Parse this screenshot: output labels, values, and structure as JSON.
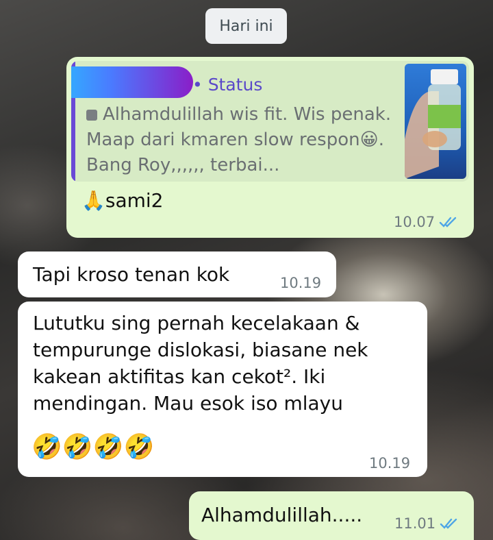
{
  "date_chip": "Hari ini",
  "messages": [
    {
      "status_label": "• Status",
      "quoted_text": "Alhamdulillah wis fit. Wis penak. Maap dari kmaren slow respon😀. Bang Roy,,,,,, terbai...",
      "text": "🙏sami2",
      "time": "10.07"
    },
    {
      "text": "Tapi kroso tenan kok",
      "time": "10.19"
    },
    {
      "text": "Lututku sing pernah kecelakaan & tempurunge dislokasi, biasane nek kakean aktifitas kan cekot². Iki mendingan. Mau esok iso mlayu",
      "emojis": "🤣🤣🤣🤣",
      "time": "10.19"
    },
    {
      "text": "Alhamdulillah.....",
      "time": "11.01"
    }
  ],
  "colors": {
    "incoming_bubble": "#ffffff",
    "outgoing_bubble": "#e4f8cf",
    "status_accent": "#5a48c9",
    "read_ticks": "#4fa6e6"
  }
}
